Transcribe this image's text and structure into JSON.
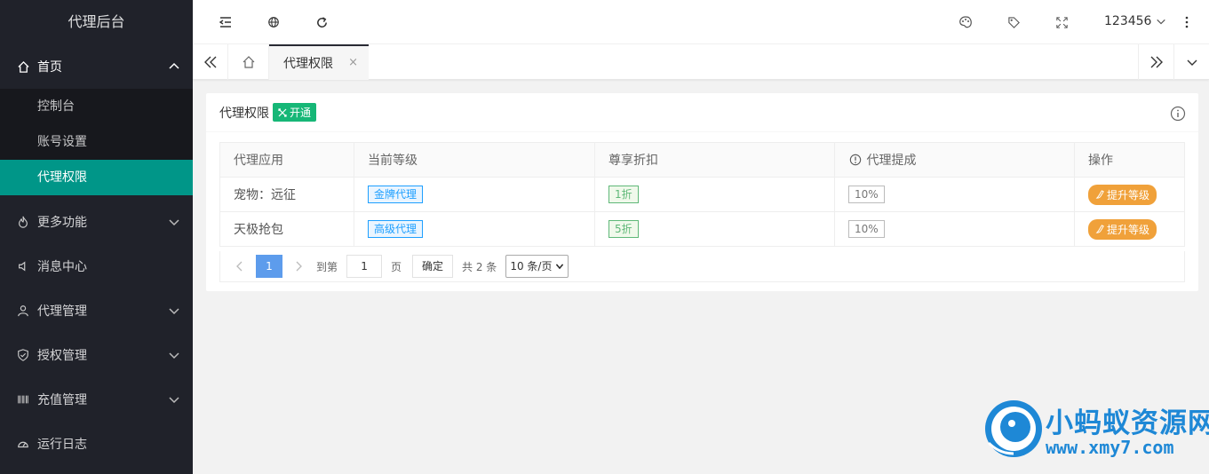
{
  "sidebar": {
    "logo": "代理后台",
    "home": "首页",
    "home_items": [
      "控制台",
      "账号设置",
      "代理权限"
    ],
    "menus": [
      {
        "label": "更多功能",
        "has_arrow": true
      },
      {
        "label": "消息中心",
        "has_arrow": false
      },
      {
        "label": "代理管理",
        "has_arrow": true
      },
      {
        "label": "授权管理",
        "has_arrow": true
      },
      {
        "label": "充值管理",
        "has_arrow": true
      },
      {
        "label": "运行日志",
        "has_arrow": false
      }
    ]
  },
  "header": {
    "user": "123456"
  },
  "tabs": {
    "active": "代理权限",
    "close": "×"
  },
  "card": {
    "title": "代理权限",
    "badge": "开通"
  },
  "table": {
    "headers": [
      "代理应用",
      "当前等级",
      "尊享折扣",
      "代理提成",
      "操作"
    ],
    "rows": [
      {
        "app": "宠物：远征",
        "level": "金牌代理",
        "discount": "1折",
        "commission": "10%",
        "action": "提升等级"
      },
      {
        "app": "天极抢包",
        "level": "高级代理",
        "discount": "5折",
        "commission": "10%",
        "action": "提升等级"
      }
    ]
  },
  "pager": {
    "current": "1",
    "goto": "到第",
    "input": "1",
    "page": "页",
    "confirm": "确定",
    "total": "共 2 条",
    "size": "10 条/页"
  },
  "watermark": {
    "title": "小蚂蚁资源网",
    "url": "www.xmy7.com"
  },
  "colors": {
    "sidebar": "#20222a",
    "active": "#009688",
    "badge": "#16b777",
    "action": "#f0a13a"
  }
}
